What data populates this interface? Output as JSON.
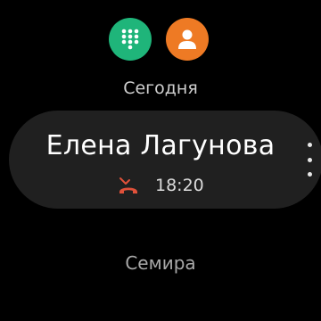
{
  "top_buttons": {
    "keypad": {
      "icon": "dialpad-icon",
      "color": "#1FB57A"
    },
    "contacts": {
      "icon": "person-icon",
      "color": "#EE7A24"
    }
  },
  "log": {
    "section_today": "Сегодня",
    "selected_call": {
      "name": "Елена Лагунова",
      "status_icon": "missed-call-icon",
      "status_color": "#E0513A",
      "time": "18:20"
    },
    "next_entry_name": "Семира"
  },
  "more_menu_icon": "more-vertical-icon"
}
